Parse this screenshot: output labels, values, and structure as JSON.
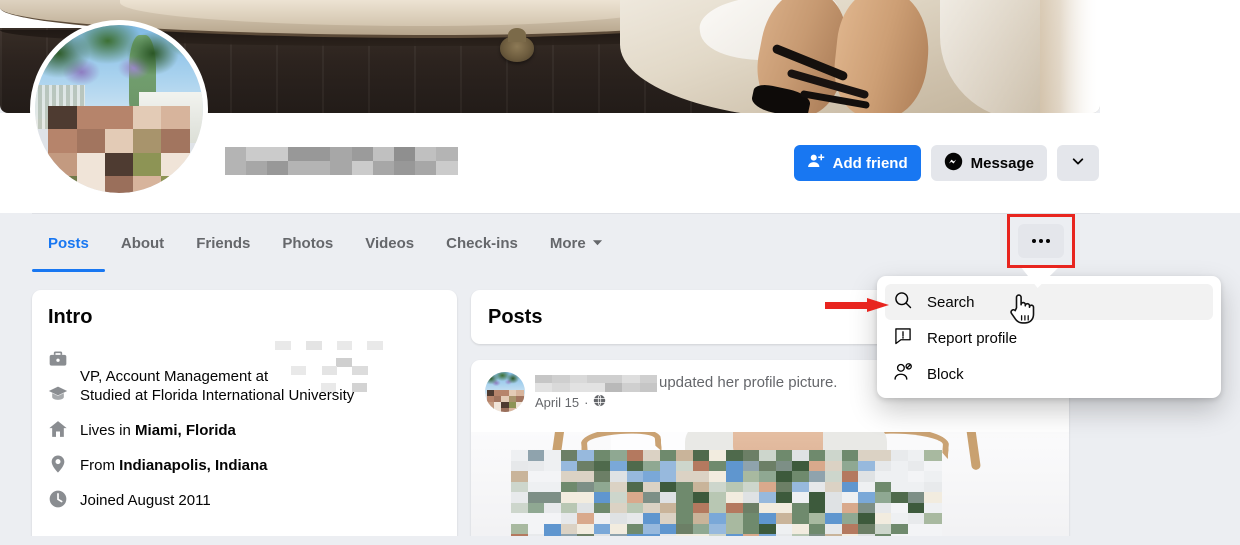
{
  "page": {
    "background_color": "#eceef2",
    "card_color": "#ffffff",
    "accent_color": "#1877f2",
    "highlight_color": "#e8251f",
    "secondary_button_color": "#e4e6eb",
    "muted_text_color": "#65676b"
  },
  "profile": {
    "name": "",
    "name_redacted": true,
    "cover_photo_alt": "person seated on ornate bench, dark wood floor",
    "profile_photo_alt": "person in front of flowering tree and blue sky, face pixelated"
  },
  "actions": {
    "add_friend_label": "Add friend",
    "add_friend_icon": "person-add-icon",
    "message_label": "Message",
    "message_icon": "messenger-icon",
    "more_caret_icon": "chevron-down-icon"
  },
  "tabs": {
    "items": [
      {
        "label": "Posts",
        "active": true
      },
      {
        "label": "About",
        "active": false
      },
      {
        "label": "Friends",
        "active": false
      },
      {
        "label": "Photos",
        "active": false
      },
      {
        "label": "Videos",
        "active": false
      },
      {
        "label": "Check-ins",
        "active": false
      },
      {
        "label": "More",
        "active": false,
        "caret_icon": "chevron-down-icon"
      }
    ],
    "overflow_button_icon": "ellipsis-icon",
    "overflow_button_highlighted": true
  },
  "dropdown": {
    "visible": true,
    "items": [
      {
        "label": "Search",
        "icon": "search-icon",
        "highlighted": true
      },
      {
        "label": "Report profile",
        "icon": "report-icon",
        "highlighted": false
      },
      {
        "label": "Block",
        "icon": "block-user-icon",
        "highlighted": false
      }
    ]
  },
  "annotations": {
    "arrow_icon": "red-arrow-icon",
    "arrow_target": "Search",
    "cursor_icon": "pointing-hand-cursor"
  },
  "intro": {
    "title": "Intro",
    "rows": [
      {
        "icon": "briefcase-icon",
        "prefix": "VP, Account Management at ",
        "value": "",
        "value_redacted": true,
        "suffix": ""
      },
      {
        "icon": "graduation-cap-icon",
        "prefix": "Studied at ",
        "value": "Florida International University",
        "bold": false,
        "suffix": ""
      },
      {
        "icon": "home-icon",
        "prefix": "Lives in ",
        "value": "Miami, Florida",
        "bold": true,
        "suffix": ""
      },
      {
        "icon": "location-pin-icon",
        "prefix": "From ",
        "value": "Indianapolis, Indiana",
        "bold": true,
        "suffix": ""
      },
      {
        "icon": "clock-icon",
        "prefix": "Joined ",
        "value": "August 2011",
        "bold": false,
        "suffix": ""
      }
    ]
  },
  "posts": {
    "section_title": "Posts",
    "entries": [
      {
        "author_name": "",
        "author_name_redacted": true,
        "action_text": "updated her profile picture.",
        "date": "April 15",
        "separator": "·",
        "privacy_icon": "globe-icon",
        "photo_alt": "hanging swing scene with pixelated center"
      }
    ]
  }
}
